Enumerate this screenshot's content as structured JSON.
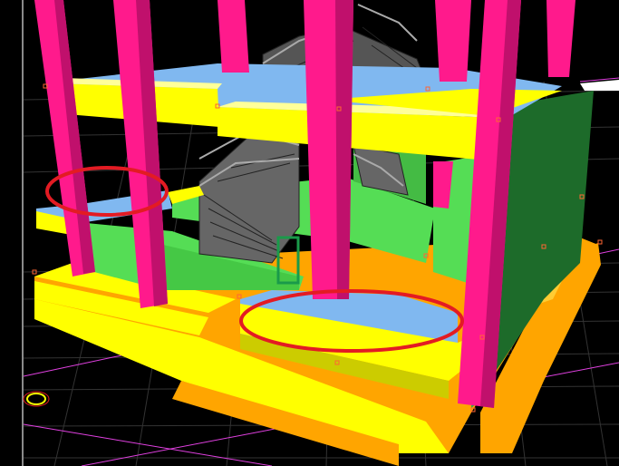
{
  "viewport": {
    "background": "#000000",
    "grid_color": "#3c3c3c",
    "axis_color": "#e040e0",
    "highlight_color": "#e31b23",
    "colors": {
      "column": "#ff1a8c",
      "column_dark": "#c0106c",
      "beam": "#ffff00",
      "beam_side": "#cccc00",
      "slab": "#80b8f0",
      "wall": "#55dd55",
      "wall_dark": "#1d6b2a",
      "foundation_top": "#ffff00",
      "foundation_side": "#ffa500",
      "stair": "#555555"
    }
  },
  "icons": [
    "rotation-gizmo-icon"
  ],
  "annotations": [
    "left-beam-ellipse",
    "front-slab-ellipse",
    "door-marker"
  ]
}
